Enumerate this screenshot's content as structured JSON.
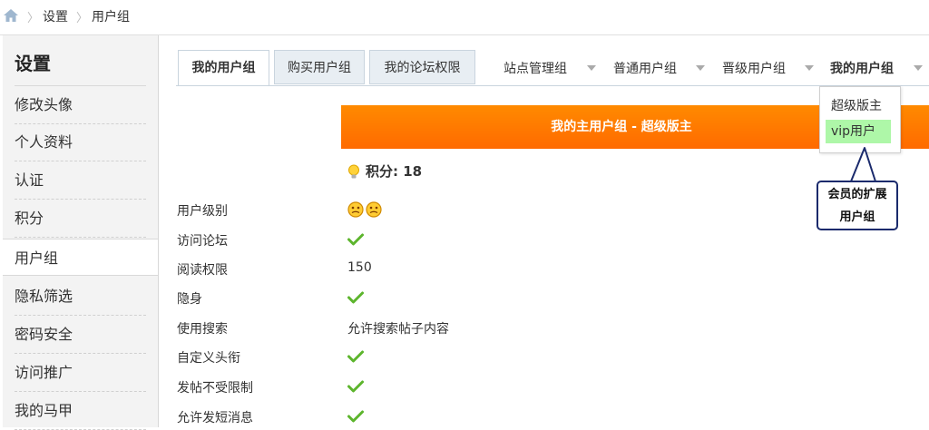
{
  "breadcrumb": {
    "items": [
      "设置",
      "用户组"
    ]
  },
  "sidebar": {
    "title": "设置",
    "items": [
      {
        "label": "修改头像"
      },
      {
        "label": "个人资料"
      },
      {
        "label": "认证"
      },
      {
        "label": "积分"
      },
      {
        "label": "用户组"
      },
      {
        "label": "隐私筛选"
      },
      {
        "label": "密码安全"
      },
      {
        "label": "访问推广"
      },
      {
        "label": "我的马甲"
      }
    ],
    "active": "用户组"
  },
  "tabs": [
    {
      "label": "我的用户组",
      "active": true
    },
    {
      "label": "购买用户组",
      "active": false
    },
    {
      "label": "我的论坛权限",
      "active": false
    }
  ],
  "group_tabs": [
    {
      "label": "站点管理组"
    },
    {
      "label": "普通用户组"
    },
    {
      "label": "晋级用户组"
    },
    {
      "label": "我的用户组",
      "bold": true
    }
  ],
  "dropdown": {
    "options": [
      "超级版主",
      "vip用户"
    ],
    "highlighted": "vip用户"
  },
  "banner": {
    "title": "我的主用户组 - 超级版主"
  },
  "points": {
    "label": "积分: 18"
  },
  "permissions": [
    {
      "label": "用户级别",
      "type": "smileys"
    },
    {
      "label": "访问论坛",
      "type": "check"
    },
    {
      "label": "阅读权限",
      "type": "text",
      "value": "150"
    },
    {
      "label": "隐身",
      "type": "check"
    },
    {
      "label": "使用搜索",
      "type": "text",
      "value": "允许搜索帖子内容"
    },
    {
      "label": "自定义头衔",
      "type": "check"
    },
    {
      "label": "发帖不受限制",
      "type": "check"
    },
    {
      "label": "允许发短消息",
      "type": "check"
    }
  ],
  "callout": {
    "line1": "会员的扩展",
    "line2": "用户组"
  },
  "colors": {
    "banner": "#ff7400",
    "highlight": "#aef7a8",
    "check": "#5db52d",
    "callout_border": "#1a2a6c"
  }
}
